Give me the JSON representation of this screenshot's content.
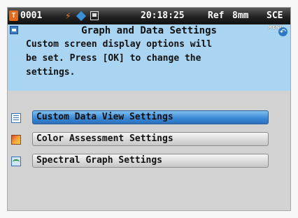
{
  "status_bar": {
    "channel_number": "0001",
    "icons": [
      "channel-badge-icon",
      "battery-bolt-icon",
      "diamond-icon",
      "lamp-icon"
    ],
    "time": "20:18:25",
    "mode": "Ref",
    "aperture": "8mm",
    "specular": "SCE"
  },
  "header": {
    "title": "Graph and Data Settings",
    "back_label": "MENU",
    "description": "Custom screen display options will\nbe set. Press [OK] to change the\nsettings."
  },
  "menu": {
    "items": [
      {
        "label": "Custom Data View Settings",
        "icon": "list-icon",
        "selected": true
      },
      {
        "label": "Color Assessment Settings",
        "icon": "color-assessment-icon",
        "selected": false
      },
      {
        "label": "Spectral Graph Settings",
        "icon": "spectral-graph-icon",
        "selected": false
      }
    ]
  },
  "colors": {
    "header_bg": "#a9d5f2",
    "selected_button": "#3c8ad6",
    "screen_bg": "#d2d2d2"
  }
}
